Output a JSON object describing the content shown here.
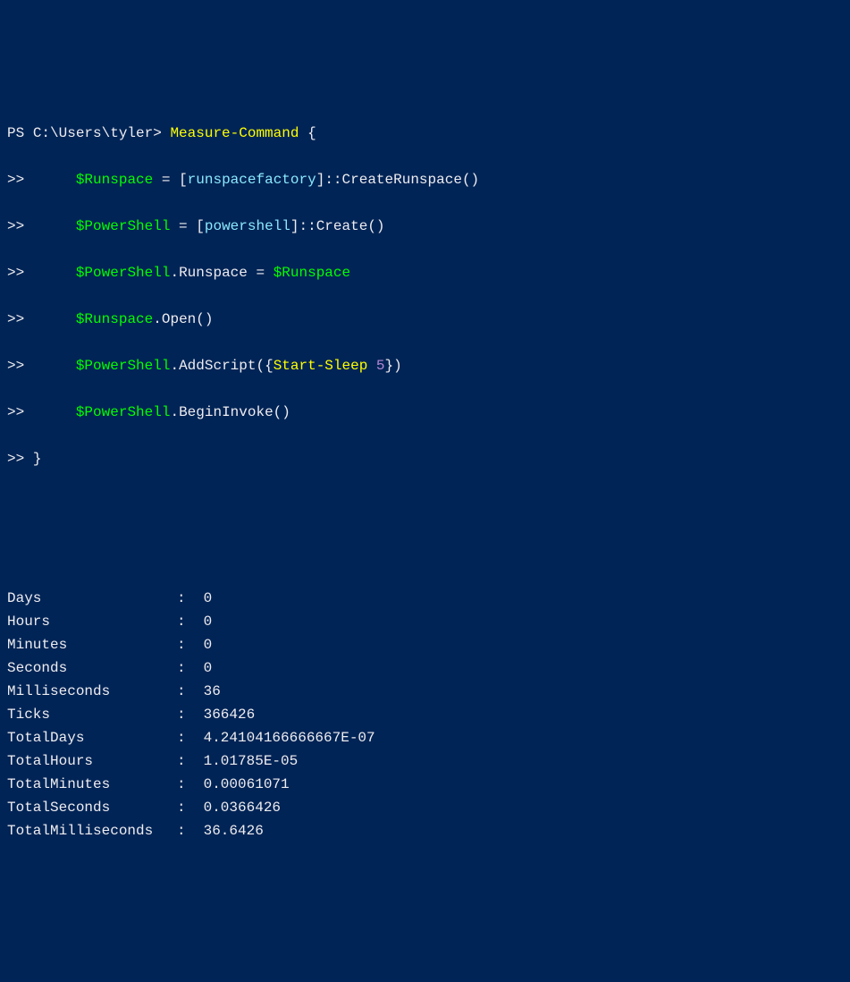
{
  "prompt": {
    "ps": "PS ",
    "path": "C:\\Users\\tyler",
    "gt": "> ",
    "cont": ">> "
  },
  "code": {
    "cmd": "Measure-Command",
    "brace_open": " {",
    "indent": "     ",
    "eq": " = ",
    "dot": ".",
    "l1_var": "$Runspace",
    "l1_lb": "[",
    "l1_type": "runspacefactory",
    "l1_rb": "]",
    "l1_call": "::CreateRunspace()",
    "l2_var": "$PowerShell",
    "l2_lb": "[",
    "l2_type": "powershell",
    "l2_rb": "]",
    "l2_call": "::Create()",
    "l3_var1": "$PowerShell",
    "l3_mem": "Runspace",
    "l3_var2": "$Runspace",
    "l4_var": "$Runspace",
    "l4_call": "Open()",
    "l5_var": "$PowerShell",
    "l5_call1": "AddScript({",
    "l5_inner": "Start-Sleep",
    "l5_sp": " ",
    "l5_num": "5",
    "l5_call2": "})",
    "l6_var": "$PowerShell",
    "l6_call": "BeginInvoke()",
    "brace_close": "}"
  },
  "output": [
    {
      "k": "Days",
      "v": "0"
    },
    {
      "k": "Hours",
      "v": "0"
    },
    {
      "k": "Minutes",
      "v": "0"
    },
    {
      "k": "Seconds",
      "v": "0"
    },
    {
      "k": "Milliseconds",
      "v": "36"
    },
    {
      "k": "Ticks",
      "v": "366426"
    },
    {
      "k": "TotalDays",
      "v": "4.24104166666667E-07"
    },
    {
      "k": "TotalHours",
      "v": "1.01785E-05"
    },
    {
      "k": "TotalMinutes",
      "v": "0.00061071"
    },
    {
      "k": "TotalSeconds",
      "v": "0.0366426"
    },
    {
      "k": "TotalMilliseconds",
      "v": "36.6426"
    }
  ],
  "colon": ":"
}
